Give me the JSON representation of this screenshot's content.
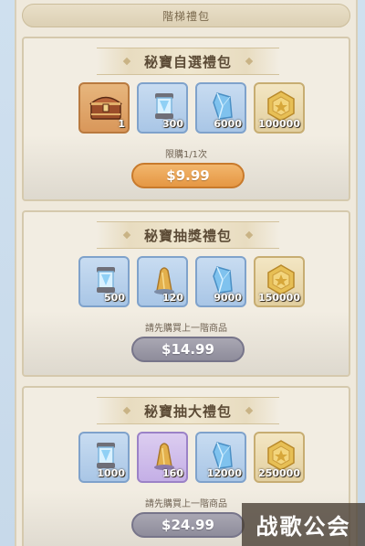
{
  "page": {
    "title": "階梯禮包"
  },
  "packs": [
    {
      "title": "秘寶自選禮包",
      "note": "限購1/1次",
      "price": "$9.99",
      "state": "active",
      "items": [
        {
          "icon": "treasure-chest-icon",
          "qty": "1",
          "color": "orange"
        },
        {
          "icon": "crystal-capsule-icon",
          "qty": "300",
          "color": "blue"
        },
        {
          "icon": "blue-crystal-icon",
          "qty": "6000",
          "color": "blue"
        },
        {
          "icon": "gold-coin-icon",
          "qty": "100000",
          "color": "gold"
        }
      ]
    },
    {
      "title": "秘寶抽獎禮包",
      "note": "請先購買上一階商品",
      "price": "$14.99",
      "state": "locked",
      "items": [
        {
          "icon": "crystal-capsule-icon",
          "qty": "500",
          "color": "blue"
        },
        {
          "icon": "gold-ore-icon",
          "qty": "120",
          "color": "blue"
        },
        {
          "icon": "blue-crystal-icon",
          "qty": "9000",
          "color": "blue"
        },
        {
          "icon": "gold-coin-icon",
          "qty": "150000",
          "color": "gold"
        }
      ]
    },
    {
      "title": "秘寶抽大禮包",
      "note": "請先購買上一階商品",
      "price": "$24.99",
      "state": "locked",
      "items": [
        {
          "icon": "crystal-capsule-icon",
          "qty": "1000",
          "color": "blue"
        },
        {
          "icon": "gold-ore-icon",
          "qty": "160",
          "color": "purple"
        },
        {
          "icon": "blue-crystal-icon",
          "qty": "12000",
          "color": "blue"
        },
        {
          "icon": "gold-coin-icon",
          "qty": "250000",
          "color": "gold"
        }
      ]
    }
  ],
  "watermark": "战歌公会"
}
